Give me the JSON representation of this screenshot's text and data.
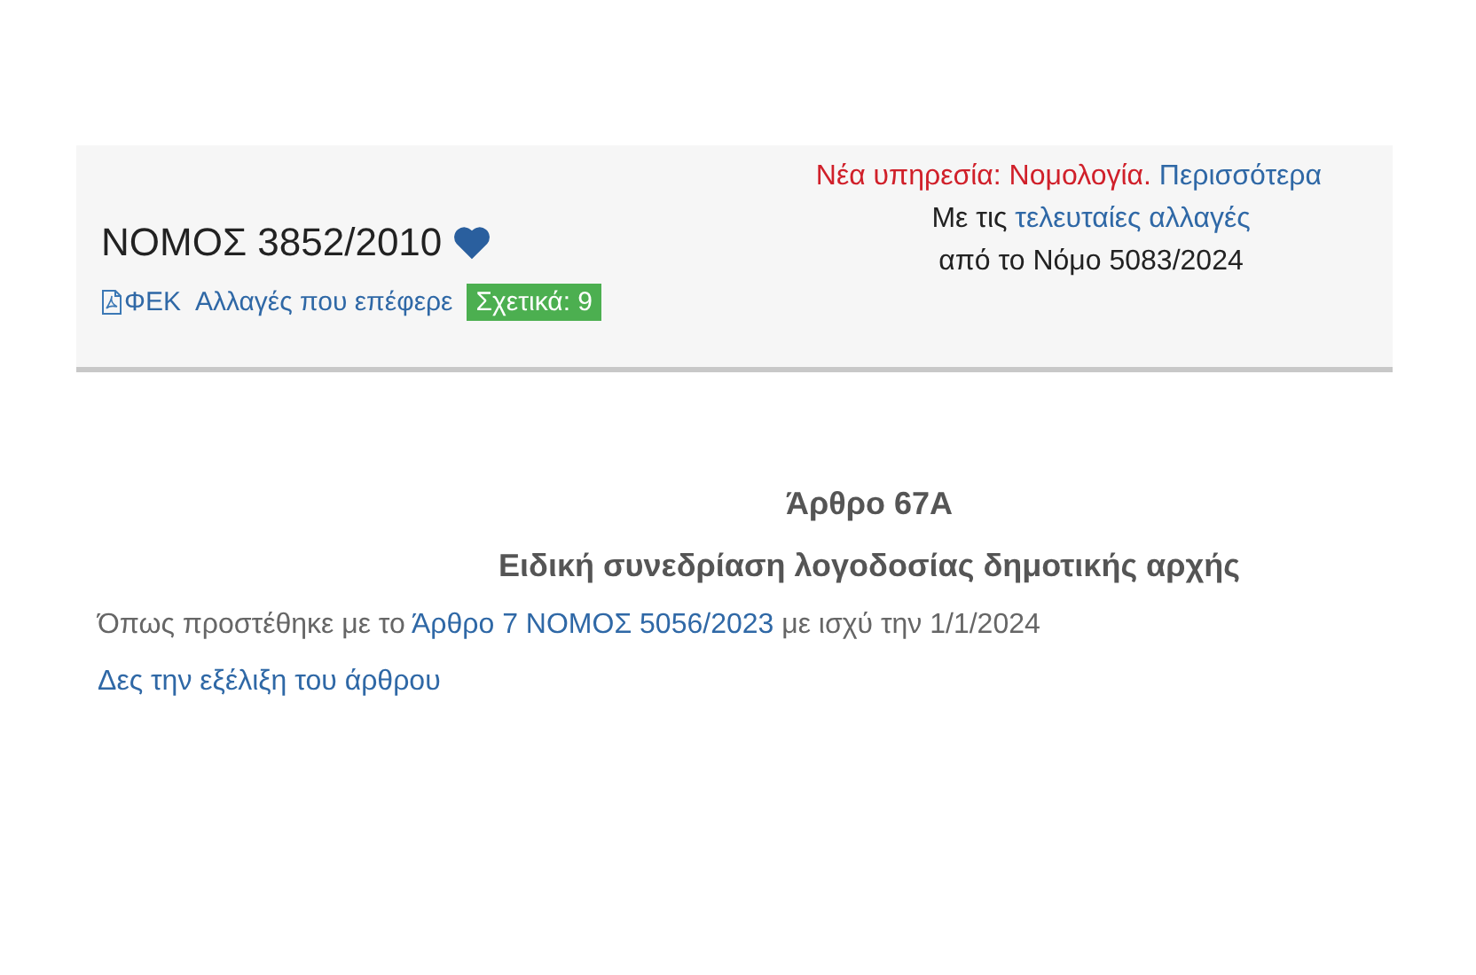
{
  "header": {
    "title": "ΝΟΜΟΣ 3852/2010",
    "favorite": true,
    "links": [
      {
        "kind": "pdf",
        "label": "ΦΕΚ"
      },
      {
        "kind": "link",
        "label": "Αλλαγές που επέφερε"
      },
      {
        "kind": "badge",
        "label": "Σχετικά: 9"
      }
    ],
    "notice": {
      "text": "Νέα υπηρεσία: Νομολογία.",
      "link": "Περισσότερα"
    },
    "updates": {
      "prefix": "Με τις",
      "link": "τελευταίες αλλαγές",
      "line2": "από το Νόμο 5083/2024"
    }
  },
  "article": {
    "number": "Άρθρο 67Α",
    "title": "Ειδική συνεδρίαση λογοδοσίας δημοτικής αρχής",
    "note": {
      "prefix": "Όπως προστέθηκε με το",
      "link": "Άρθρο 7 ΝΟΜΟΣ 5056/2023",
      "suffix": "με ισχύ την 1/1/2024"
    },
    "history_link": "Δες την εξέλιξη του άρθρου"
  }
}
